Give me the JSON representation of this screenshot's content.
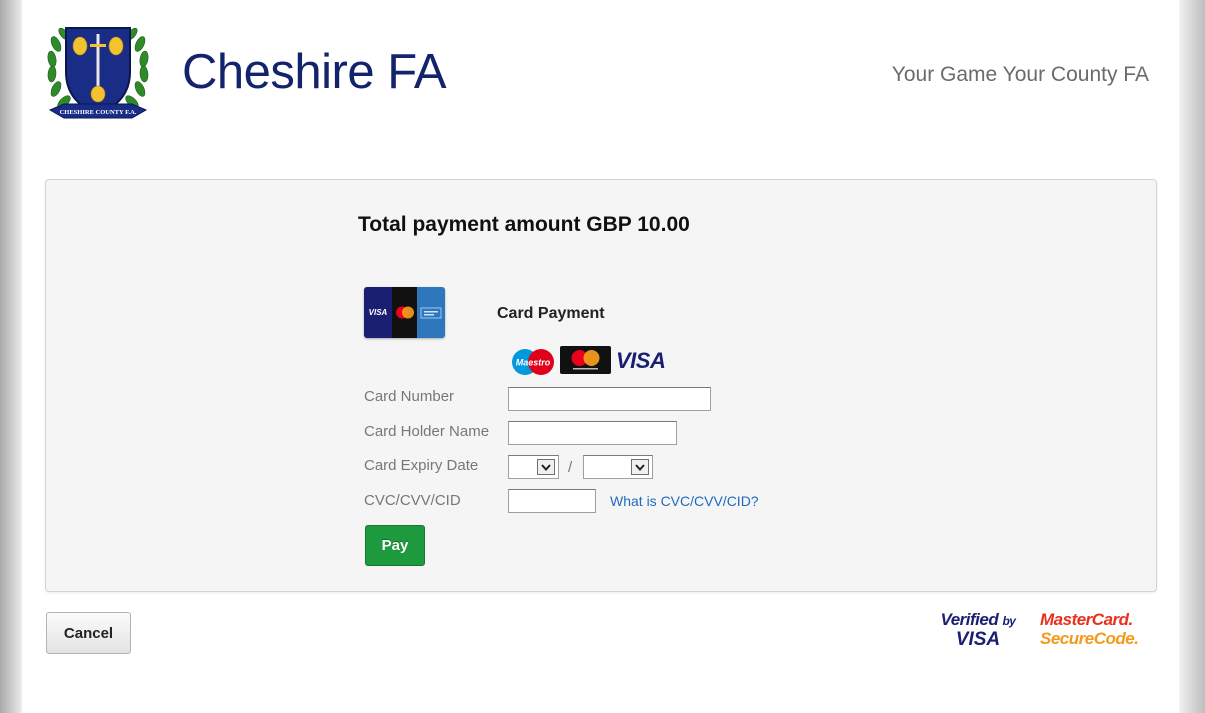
{
  "header": {
    "org_name": "Cheshire FA",
    "tagline": "Your Game Your County FA",
    "crest_caption": "CHESHIRE COUNTY F.A."
  },
  "payment": {
    "total_text": "Total payment amount GBP 10.00",
    "method_label": "Card Payment",
    "card_tile_visa": "VISA",
    "accepted_cards": {
      "maestro": "Maestro",
      "visa": "VISA"
    },
    "fields": {
      "card_number_label": "Card Number",
      "card_number_value": "",
      "card_holder_label": "Card Holder Name",
      "card_holder_value": "",
      "expiry_label": "Card Expiry Date",
      "expiry_month": "",
      "expiry_year": "",
      "expiry_separator": "/",
      "cvc_label": "CVC/CVV/CID",
      "cvc_value": "",
      "cvc_help_link": "What is CVC/CVV/CID?"
    },
    "pay_label": "Pay"
  },
  "footer": {
    "cancel_label": "Cancel",
    "verified_by": "Verified",
    "verified_by_small": "by",
    "verified_visa": "VISA",
    "mastercard": "MasterCard.",
    "securecode": "SecureCode."
  },
  "colors": {
    "brand": "#13246a",
    "pay_button": "#1e9a3e",
    "link": "#1f6ac0"
  }
}
